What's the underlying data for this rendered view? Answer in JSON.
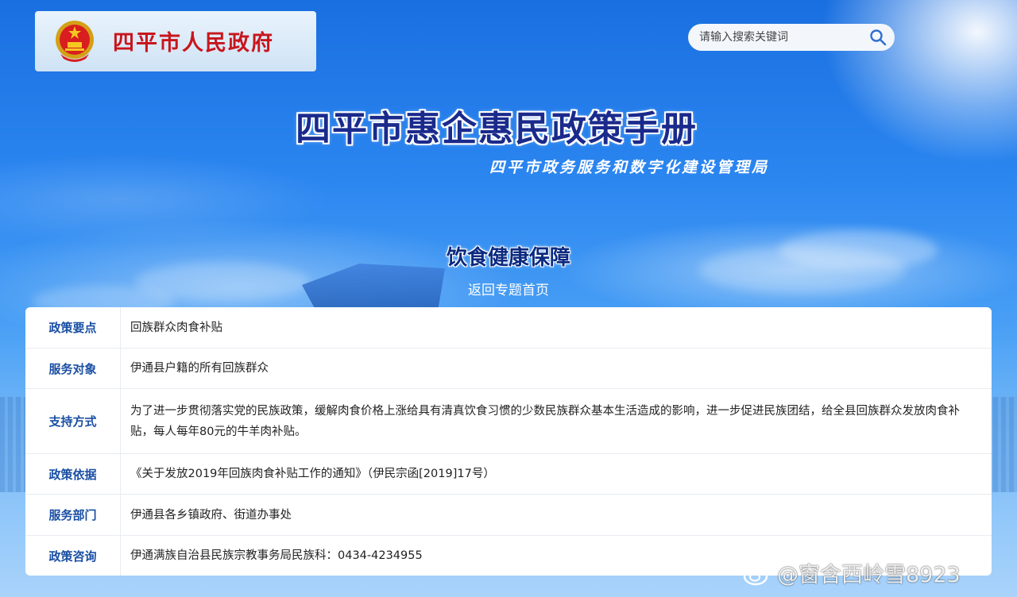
{
  "header": {
    "logo_text": "四平市人民政府",
    "search_placeholder": "请输入搜索关键词"
  },
  "banner": {
    "title": "四平市惠企惠民政策手册",
    "subtitle": "四平市政务服务和数字化建设管理局"
  },
  "topic": {
    "title": "饮食健康保障",
    "back_link": "返回专题首页"
  },
  "policy": {
    "rows": [
      {
        "label": "政策要点",
        "value": "回族群众肉食补贴"
      },
      {
        "label": "服务对象",
        "value": "伊通县户籍的所有回族群众"
      },
      {
        "label": "支持方式",
        "value": "为了进一步贯彻落实党的民族政策，缓解肉食价格上涨给具有清真饮食习惯的少数民族群众基本生活造成的影响，进一步促进民族团结，给全县回族群众发放肉食补贴，每人每年80元的牛羊肉补贴。"
      },
      {
        "label": "政策依据",
        "value": "《关于发放2019年回族肉食补贴工作的通知》（伊民宗函[2019]17号）"
      },
      {
        "label": "服务部门",
        "value": "伊通县各乡镇政府、街道办事处"
      },
      {
        "label": "政策咨询",
        "value": "伊通满族自治县民族宗教事务局民族科：0434-4234955"
      }
    ]
  },
  "watermark": {
    "text": "@窗含西岭雪8923",
    "icon": "weibo-icon"
  },
  "colors": {
    "logo_red": "#c8161d",
    "title_navy": "#1a2a8c",
    "label_blue": "#1a4fa3",
    "sky_blue": "#2b86f0"
  }
}
